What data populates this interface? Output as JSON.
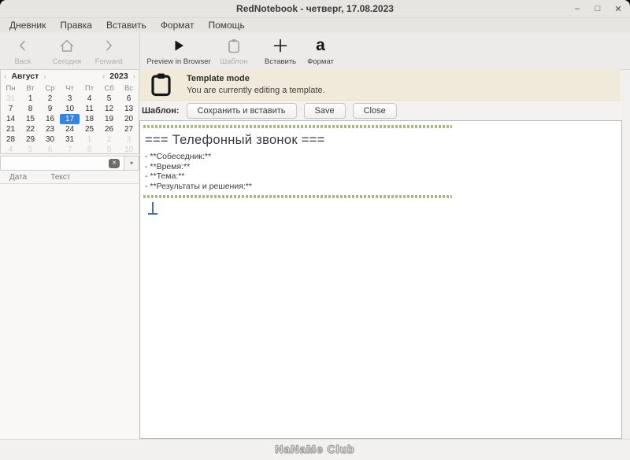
{
  "window": {
    "title": "RedNotebook - четверг, 17.08.2023",
    "controls": {
      "minimize": "–",
      "maximize": "□",
      "close": "✕"
    }
  },
  "menu": {
    "items": [
      "Дневник",
      "Правка",
      "Вставить",
      "Формат",
      "Помощь"
    ]
  },
  "toolbar": {
    "back": "Back",
    "today": "Сегодня",
    "forward": "Forward",
    "preview": "Preview in Browser",
    "template": "Шаблон",
    "insert": "Вставить",
    "format": "Формат",
    "format_glyph": "a"
  },
  "calendar": {
    "month": "Август",
    "year": "2023",
    "nav_prev": "‹",
    "nav_next": "›",
    "selected_day": "17",
    "day_names": [
      "Пн",
      "Вт",
      "Ср",
      "Чт",
      "Пт",
      "Сб",
      "Вс"
    ],
    "weeks": [
      [
        {
          "d": "31",
          "muted": true
        },
        {
          "d": "1"
        },
        {
          "d": "2"
        },
        {
          "d": "3"
        },
        {
          "d": "4"
        },
        {
          "d": "5"
        },
        {
          "d": "6"
        }
      ],
      [
        {
          "d": "7"
        },
        {
          "d": "8"
        },
        {
          "d": "9"
        },
        {
          "d": "10"
        },
        {
          "d": "11"
        },
        {
          "d": "12"
        },
        {
          "d": "13"
        }
      ],
      [
        {
          "d": "14"
        },
        {
          "d": "15"
        },
        {
          "d": "16"
        },
        {
          "d": "17",
          "selected": true
        },
        {
          "d": "18"
        },
        {
          "d": "19"
        },
        {
          "d": "20"
        }
      ],
      [
        {
          "d": "21"
        },
        {
          "d": "22"
        },
        {
          "d": "23"
        },
        {
          "d": "24"
        },
        {
          "d": "25"
        },
        {
          "d": "26"
        },
        {
          "d": "27"
        }
      ],
      [
        {
          "d": "28"
        },
        {
          "d": "29"
        },
        {
          "d": "30"
        },
        {
          "d": "31"
        },
        {
          "d": "1",
          "muted": true
        },
        {
          "d": "2",
          "muted": true
        },
        {
          "d": "3",
          "muted": true
        }
      ],
      [
        {
          "d": "4",
          "muted": true
        },
        {
          "d": "5",
          "muted": true
        },
        {
          "d": "6",
          "muted": true
        },
        {
          "d": "7",
          "muted": true
        },
        {
          "d": "8",
          "muted": true
        },
        {
          "d": "9",
          "muted": true
        },
        {
          "d": "10",
          "muted": true
        }
      ]
    ]
  },
  "search": {
    "value": "",
    "clear_glyph": "✕",
    "dropdown_glyph": "▾"
  },
  "results": {
    "columns": [
      "Дата",
      "Текст"
    ]
  },
  "banner": {
    "title": "Template mode",
    "subtitle": "You are currently editing a template."
  },
  "template_bar": {
    "label": "Шаблон:",
    "buttons": [
      "Сохранить и вставить",
      "Save",
      "Close"
    ]
  },
  "editor": {
    "heading": "=== Телефонный звонок ===",
    "lines": [
      "- **Собеседник:**",
      "- **Время:**",
      "- **Тема:**",
      "- **Результаты и решения:**"
    ]
  },
  "watermark": "NaNaMe Club",
  "colors": {
    "selected_day_bg": "#3584e4",
    "banner_bg": "#f1eada",
    "dash_green": "#aab684",
    "cursor_blue": "#4472b0",
    "titlebar_bg": "#e7e5e2"
  }
}
